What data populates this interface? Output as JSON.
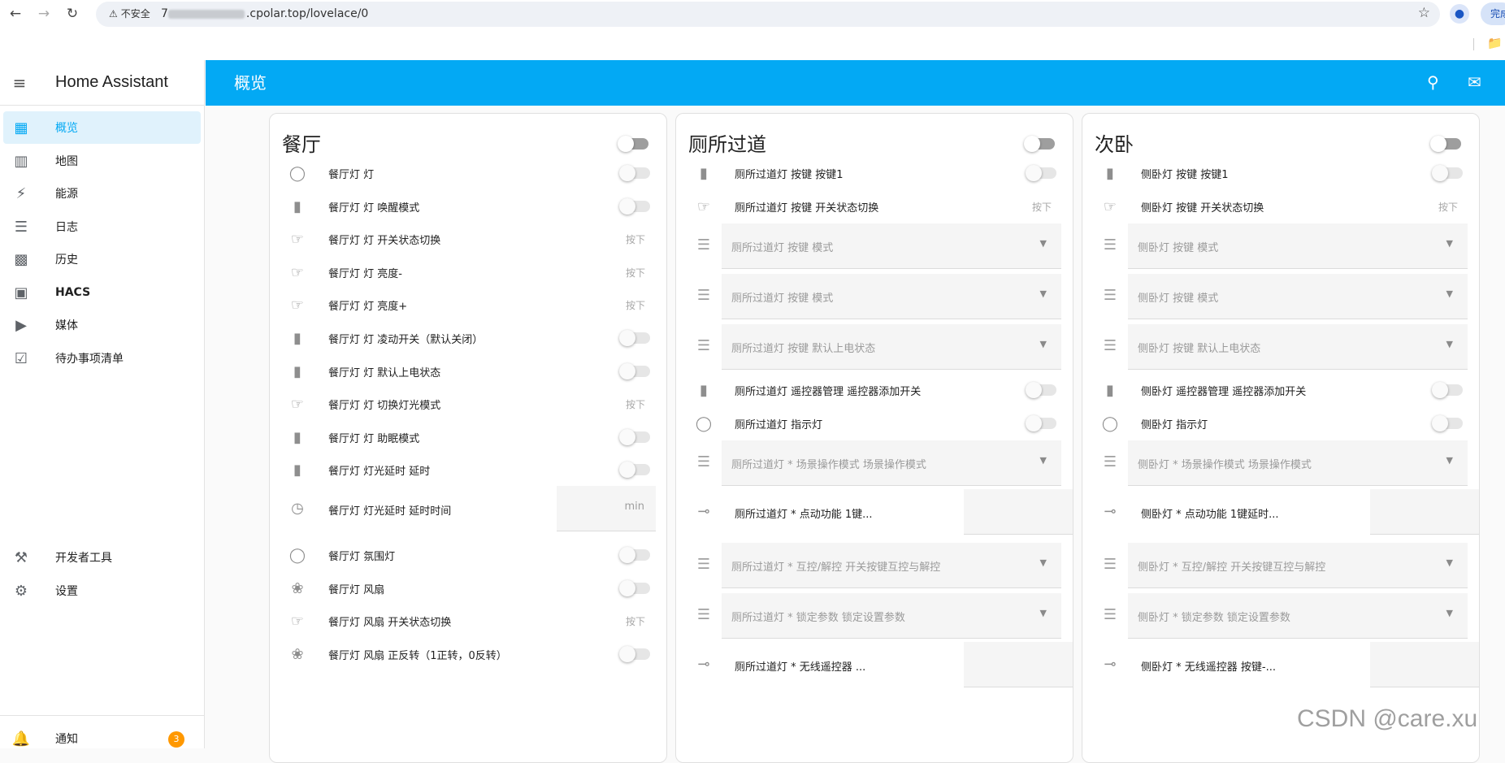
{
  "browser": {
    "security_label": "不安全",
    "url_prefix": "7",
    "url_suffix": ".cpolar.top/lovelace/0",
    "side_chip_label": "完成"
  },
  "sidebar": {
    "title": "Home Assistant",
    "items": [
      {
        "label": "概览",
        "icon": "dashboard-icon"
      },
      {
        "label": "地图",
        "icon": "map-icon"
      },
      {
        "label": "能源",
        "icon": "lightning-icon"
      },
      {
        "label": "日志",
        "icon": "list-icon"
      },
      {
        "label": "历史",
        "icon": "chart-icon"
      },
      {
        "label": "HACS",
        "icon": "hacs-icon"
      },
      {
        "label": "媒体",
        "icon": "media-icon"
      },
      {
        "label": "待办事项清单",
        "icon": "clipboard-icon"
      }
    ],
    "developer_tools": "开发者工具",
    "settings": "设置",
    "notifications": "通知",
    "notifications_count": "3"
  },
  "appbar": {
    "title": "概览"
  },
  "cards": {
    "dining": {
      "title": "餐厅",
      "rows": [
        {
          "label": "餐厅灯 灯",
          "control": "toggle"
        },
        {
          "label": "餐厅灯 灯 唤醒模式",
          "control": "toggle"
        },
        {
          "label": "餐厅灯 灯 开关状态切换",
          "control": "press"
        },
        {
          "label": "餐厅灯 灯 亮度-",
          "control": "press"
        },
        {
          "label": "餐厅灯 灯 亮度+",
          "control": "press"
        },
        {
          "label": "餐厅灯 灯 凌动开关（默认关闭）",
          "control": "toggle"
        },
        {
          "label": "餐厅灯 灯 默认上电状态",
          "control": "toggle"
        },
        {
          "label": "餐厅灯 灯 切换灯光模式",
          "control": "press"
        },
        {
          "label": "餐厅灯 灯 助眠模式",
          "control": "toggle"
        },
        {
          "label": "餐厅灯 灯光延时 延时",
          "control": "toggle"
        },
        {
          "label": "餐厅灯 灯光延时 延时时间",
          "control": "number",
          "unit": "min"
        },
        {
          "label": "餐厅灯 氛围灯",
          "control": "toggle"
        },
        {
          "label": "餐厅灯 风扇",
          "control": "toggle"
        },
        {
          "label": "餐厅灯 风扇 开关状态切换",
          "control": "press"
        },
        {
          "label": "餐厅灯 风扇 正反转（1正转，0反转）",
          "control": "toggle"
        }
      ]
    },
    "toilet": {
      "title": "厕所过道",
      "rows": [
        {
          "label": "厕所过道灯 按键 按键1",
          "control": "toggle"
        },
        {
          "label": "厕所过道灯 按键 开关状态切换",
          "control": "press"
        },
        {
          "label": "厕所过道灯 按键 模式",
          "control": "select"
        },
        {
          "label": "厕所过道灯 按键 模式",
          "control": "select"
        },
        {
          "label": "厕所过道灯 按键 默认上电状态",
          "control": "select"
        },
        {
          "label": "厕所过道灯 遥控器管理 遥控器添加开关",
          "control": "toggle"
        },
        {
          "label": "厕所过道灯 指示灯",
          "control": "toggle"
        },
        {
          "label": "厕所过道灯 * 场景操作模式 场景操作模式",
          "control": "select"
        },
        {
          "label": "厕所过道灯 * 点动功能 1键...",
          "control": "blank"
        },
        {
          "label": "厕所过道灯 * 互控/解控 开关按键互控与解控",
          "control": "select"
        },
        {
          "label": "厕所过道灯 * 锁定参数 锁定设置参数",
          "control": "select"
        },
        {
          "label": "厕所过道灯 * 无线遥控器 ...",
          "control": "blank"
        }
      ]
    },
    "bedroom": {
      "title": "次卧",
      "rows": [
        {
          "label": "侧卧灯 按键 按键1",
          "control": "toggle"
        },
        {
          "label": "侧卧灯 按键 开关状态切换",
          "control": "press"
        },
        {
          "label": "侧卧灯 按键 模式",
          "control": "select"
        },
        {
          "label": "侧卧灯 按键 模式",
          "control": "select"
        },
        {
          "label": "侧卧灯 按键 默认上电状态",
          "control": "select"
        },
        {
          "label": "侧卧灯 遥控器管理 遥控器添加开关",
          "control": "toggle"
        },
        {
          "label": "侧卧灯 指示灯",
          "control": "toggle"
        },
        {
          "label": "侧卧灯 * 场景操作模式 场景操作模式",
          "control": "select"
        },
        {
          "label": "侧卧灯 * 点动功能 1键延时...",
          "control": "blank"
        },
        {
          "label": "侧卧灯 * 互控/解控 开关按键互控与解控",
          "control": "select"
        },
        {
          "label": "侧卧灯 * 锁定参数 锁定设置参数",
          "control": "select"
        },
        {
          "label": "侧卧灯 * 无线遥控器 按键-...",
          "control": "blank"
        }
      ]
    }
  },
  "press_label": "按下",
  "watermark": "CSDN @care.xu"
}
